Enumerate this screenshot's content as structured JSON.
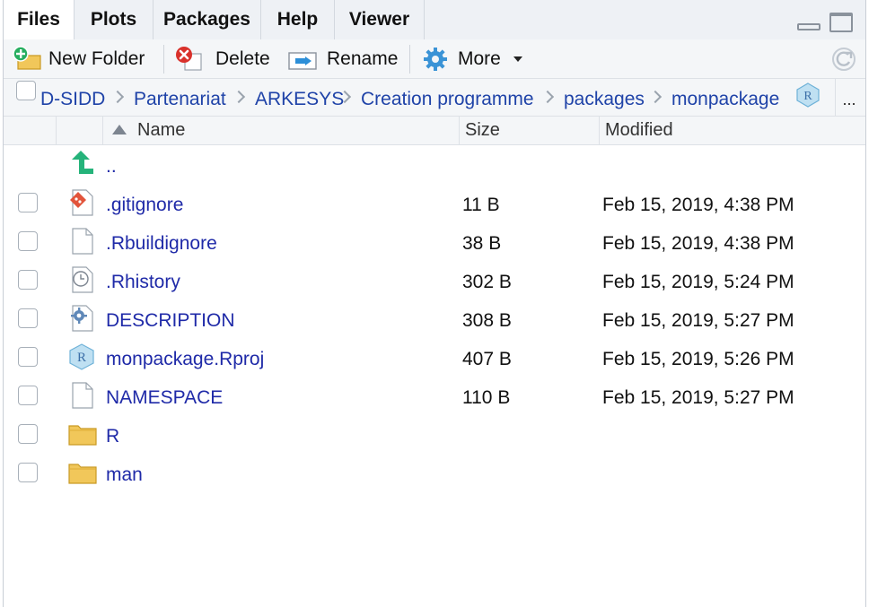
{
  "tabs": [
    {
      "label": "Files",
      "active": true
    },
    {
      "label": "Plots",
      "active": false
    },
    {
      "label": "Packages",
      "active": false
    },
    {
      "label": "Help",
      "active": false
    },
    {
      "label": "Viewer",
      "active": false
    }
  ],
  "toolbar": {
    "new_folder": "New Folder",
    "delete": "Delete",
    "rename": "Rename",
    "more": "More"
  },
  "breadcrumb": {
    "items": [
      "D-SIDD",
      "Partenariat",
      "ARKESYS",
      "Creation programme",
      "packages",
      "monpackage"
    ],
    "overflow": "..."
  },
  "header": {
    "name": "Name",
    "size": "Size",
    "modified": "Modified"
  },
  "parent_dir": "..",
  "files": [
    {
      "name": ".gitignore",
      "size": "11 B",
      "modified": "Feb 15, 2019, 4:38 PM",
      "icon": "git-file-icon"
    },
    {
      "name": ".Rbuildignore",
      "size": "38 B",
      "modified": "Feb 15, 2019, 4:38 PM",
      "icon": "text-file-icon"
    },
    {
      "name": ".Rhistory",
      "size": "302 B",
      "modified": "Feb 15, 2019, 5:24 PM",
      "icon": "history-file-icon"
    },
    {
      "name": "DESCRIPTION",
      "size": "308 B",
      "modified": "Feb 15, 2019, 5:27 PM",
      "icon": "gear-file-icon"
    },
    {
      "name": "monpackage.Rproj",
      "size": "407 B",
      "modified": "Feb 15, 2019, 5:26 PM",
      "icon": "rproj-file-icon"
    },
    {
      "name": "NAMESPACE",
      "size": "110 B",
      "modified": "Feb 15, 2019, 5:27 PM",
      "icon": "text-file-icon"
    },
    {
      "name": "R",
      "size": "",
      "modified": "",
      "icon": "folder-icon"
    },
    {
      "name": "man",
      "size": "",
      "modified": "",
      "icon": "folder-icon"
    }
  ],
  "colors": {
    "link": "#1f2aa8",
    "toolbar_bg": "#f4f6f8",
    "folder": "#f1c75a",
    "up_arrow": "#25b37a"
  }
}
